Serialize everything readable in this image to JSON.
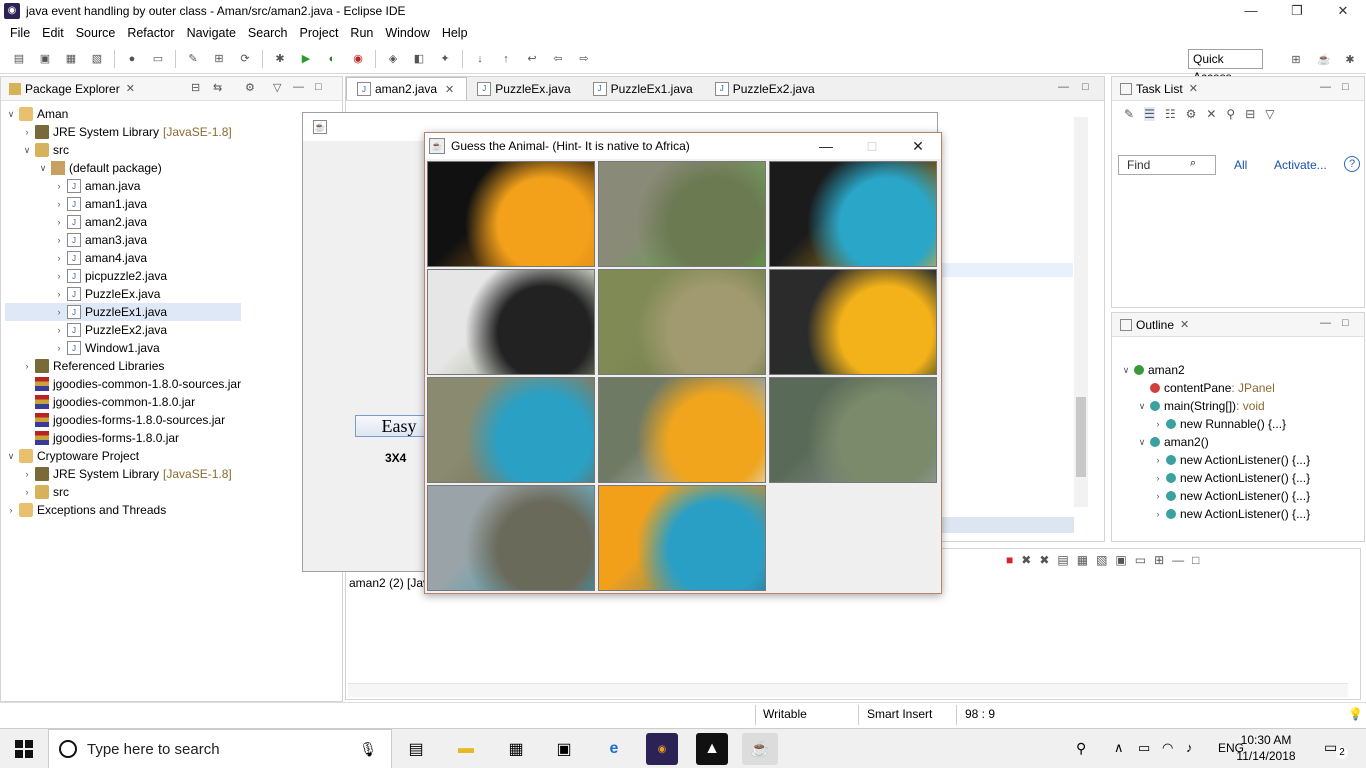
{
  "window": {
    "title": "java event handling by outer class - Aman/src/aman2.java - Eclipse IDE",
    "controls": [
      "—",
      "❐",
      "✕"
    ]
  },
  "menu": [
    "File",
    "Edit",
    "Source",
    "Refactor",
    "Navigate",
    "Search",
    "Project",
    "Run",
    "Window",
    "Help"
  ],
  "toolbar": {
    "quick_access": "Quick Access"
  },
  "package_explorer": {
    "title": "Package Explorer",
    "rows": [
      {
        "indent": 0,
        "twisty": "∨",
        "icon": "project",
        "label": "Aman",
        "extra": ""
      },
      {
        "indent": 1,
        "twisty": "›",
        "icon": "lib",
        "label": "JRE System Library",
        "extra": "[JavaSE-1.8]"
      },
      {
        "indent": 1,
        "twisty": "∨",
        "icon": "folder",
        "label": "src",
        "extra": ""
      },
      {
        "indent": 2,
        "twisty": "∨",
        "icon": "pkg",
        "label": "(default package)",
        "extra": ""
      },
      {
        "indent": 3,
        "twisty": "›",
        "icon": "java",
        "label": "aman.java",
        "extra": ""
      },
      {
        "indent": 3,
        "twisty": "›",
        "icon": "java",
        "label": "aman1.java",
        "extra": ""
      },
      {
        "indent": 3,
        "twisty": "›",
        "icon": "java",
        "label": "aman2.java",
        "extra": ""
      },
      {
        "indent": 3,
        "twisty": "›",
        "icon": "java",
        "label": "aman3.java",
        "extra": ""
      },
      {
        "indent": 3,
        "twisty": "›",
        "icon": "java",
        "label": "aman4.java",
        "extra": ""
      },
      {
        "indent": 3,
        "twisty": "›",
        "icon": "java",
        "label": "picpuzzle2.java",
        "extra": ""
      },
      {
        "indent": 3,
        "twisty": "›",
        "icon": "java",
        "label": "PuzzleEx.java",
        "extra": ""
      },
      {
        "indent": 3,
        "twisty": "›",
        "icon": "java",
        "label": "PuzzleEx1.java",
        "extra": "",
        "selected": true
      },
      {
        "indent": 3,
        "twisty": "›",
        "icon": "java",
        "label": "PuzzleEx2.java",
        "extra": ""
      },
      {
        "indent": 3,
        "twisty": "›",
        "icon": "java",
        "label": "Window1.java",
        "extra": ""
      },
      {
        "indent": 1,
        "twisty": "›",
        "icon": "lib",
        "label": "Referenced Libraries",
        "extra": ""
      },
      {
        "indent": 1,
        "twisty": "",
        "icon": "jar",
        "label": "jgoodies-common-1.8.0-sources.jar",
        "extra": ""
      },
      {
        "indent": 1,
        "twisty": "",
        "icon": "jar",
        "label": "jgoodies-common-1.8.0.jar",
        "extra": ""
      },
      {
        "indent": 1,
        "twisty": "",
        "icon": "jar",
        "label": "jgoodies-forms-1.8.0-sources.jar",
        "extra": ""
      },
      {
        "indent": 1,
        "twisty": "",
        "icon": "jar",
        "label": "jgoodies-forms-1.8.0.jar",
        "extra": ""
      },
      {
        "indent": 0,
        "twisty": "∨",
        "icon": "project",
        "label": "Cryptoware Project",
        "extra": ""
      },
      {
        "indent": 1,
        "twisty": "›",
        "icon": "lib",
        "label": "JRE System Library",
        "extra": "[JavaSE-1.8]"
      },
      {
        "indent": 1,
        "twisty": "›",
        "icon": "folder",
        "label": "src",
        "extra": ""
      },
      {
        "indent": 0,
        "twisty": "›",
        "icon": "project",
        "label": "Exceptions and Threads",
        "extra": ""
      }
    ]
  },
  "editor": {
    "tabs": [
      {
        "label": "aman2.java",
        "active": true
      },
      {
        "label": "PuzzleEx.java",
        "active": false
      },
      {
        "label": "PuzzleEx1.java",
        "active": false
      },
      {
        "label": "PuzzleEx2.java",
        "active": false
      }
    ]
  },
  "console": {
    "label": "aman2 (2) [Jav"
  },
  "task_list": {
    "title": "Task List",
    "find_placeholder": "Find",
    "all": "All",
    "activate": "Activate..."
  },
  "outline": {
    "title": "Outline",
    "rows": [
      {
        "indent": 0,
        "twisty": "∨",
        "label": "aman2",
        "type": ""
      },
      {
        "indent": 1,
        "twisty": "",
        "label": "contentPane",
        "type": " : JPanel"
      },
      {
        "indent": 1,
        "twisty": "∨",
        "label": "main(String[])",
        "type": " : void"
      },
      {
        "indent": 2,
        "twisty": "›",
        "label": "new Runnable() {...}",
        "type": ""
      },
      {
        "indent": 1,
        "twisty": "∨",
        "label": "aman2()",
        "type": ""
      },
      {
        "indent": 2,
        "twisty": "›",
        "label": "new ActionListener() {...}",
        "type": ""
      },
      {
        "indent": 2,
        "twisty": "›",
        "label": "new ActionListener() {...}",
        "type": ""
      },
      {
        "indent": 2,
        "twisty": "›",
        "label": "new ActionListener() {...}",
        "type": ""
      },
      {
        "indent": 2,
        "twisty": "›",
        "label": "new ActionListener() {...}",
        "type": ""
      }
    ]
  },
  "statusbar": {
    "writable": "Writable",
    "insert_mode": "Smart Insert",
    "position": "98 : 9"
  },
  "bg_frame": {
    "button": "Easy",
    "grid": "3X4"
  },
  "puzzle": {
    "title": "Guess the Animal- (Hint- It is native to Africa)",
    "tiles": [
      {
        "colors": [
          "#111111",
          "#f3a11a",
          "#e98a10"
        ]
      },
      {
        "colors": [
          "#8a8a78",
          "#6c7a52",
          "#4fae3a"
        ]
      },
      {
        "colors": [
          "#1b1b1b",
          "#2aa6c8",
          "#f0b21e"
        ]
      },
      {
        "colors": [
          "#e6e6e6",
          "#222222",
          "#7a8a68"
        ]
      },
      {
        "colors": [
          "#7f8a55",
          "#a19a70",
          "#6e7a48"
        ]
      },
      {
        "colors": [
          "#2b2b2b",
          "#f3b21a",
          "#1f3a2a"
        ]
      },
      {
        "colors": [
          "#8a8a70",
          "#2aa0c4",
          "#6a6a58"
        ]
      },
      {
        "colors": [
          "#6f7a65",
          "#f0a51c",
          "#e7e7e7"
        ]
      },
      {
        "colors": [
          "#5a6a58",
          "#7a8a6a",
          "#9aa0a8"
        ]
      },
      {
        "colors": [
          "#9aa4a8",
          "#6a6a5a",
          "#2a9ec0"
        ]
      },
      {
        "colors": [
          "#f2a01a",
          "#2a9fc6",
          "#1e7aa8"
        ]
      },
      {
        "colors": null
      }
    ]
  },
  "taskbar": {
    "search_placeholder": "Type here to search",
    "time": "10:30 AM",
    "date": "11/14/2018",
    "lang": "ENG",
    "notif": "2"
  }
}
